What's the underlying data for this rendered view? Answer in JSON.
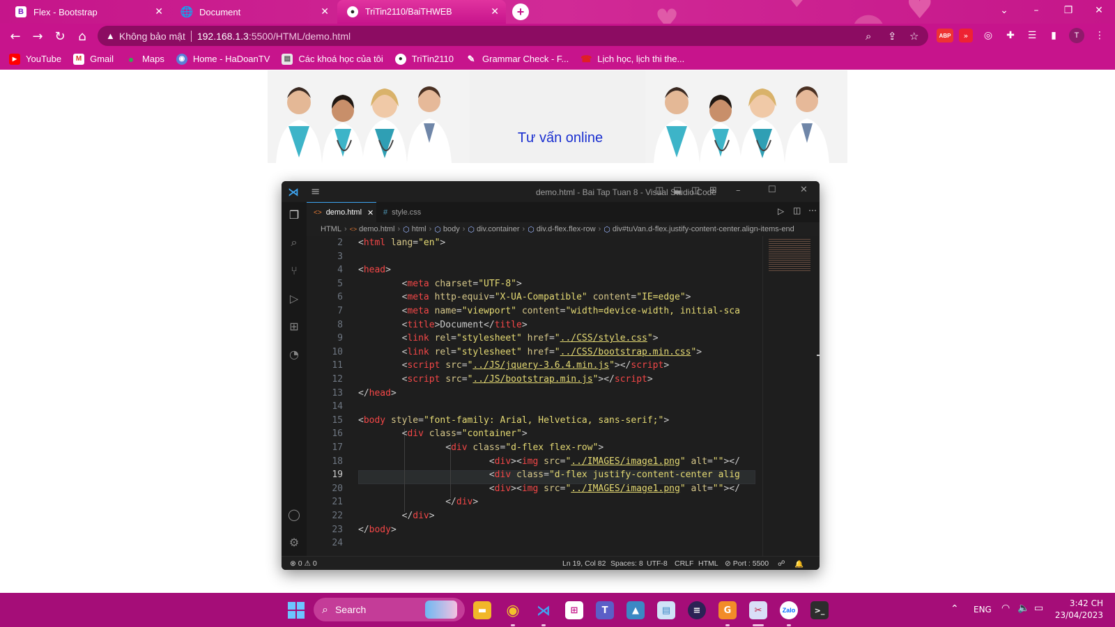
{
  "browser": {
    "tabs": [
      {
        "title": "Flex - Bootstrap",
        "favicon": "B",
        "active": false
      },
      {
        "title": "Document",
        "favicon": "globe-icon",
        "active": false
      },
      {
        "title": "TriTin2110/BaiTHWEB",
        "favicon": "github-icon",
        "active": true
      }
    ],
    "address": {
      "security": "Không bảo mật",
      "host": "192.168.1.3",
      "path": ":5500/HTML/demo.html"
    },
    "profile_initial": "T",
    "ext_abp": "ABP",
    "bookmarks": [
      {
        "label": "YouTube",
        "icon": "youtube-icon"
      },
      {
        "label": "Gmail",
        "icon": "gmail-icon"
      },
      {
        "label": "Maps",
        "icon": "maps-icon"
      },
      {
        "label": "Home - HaDoanTV",
        "icon": "globe-icon"
      },
      {
        "label": "Các khoá học của tôi",
        "icon": "course-icon"
      },
      {
        "label": "TriTin2110",
        "icon": "github-icon"
      },
      {
        "label": "Grammar Check - F...",
        "icon": "grammar-icon"
      },
      {
        "label": "Lịch học, lịch thi the...",
        "icon": "calendar-icon"
      }
    ],
    "colors": {
      "chrome": "#c7148c",
      "accent": "#e1339f"
    }
  },
  "page": {
    "banner_text": "Tư vấn online"
  },
  "vscode": {
    "title": "demo.html - Bai Tap Tuan 8 - Visual Studio Code",
    "tabs": [
      {
        "label": "demo.html",
        "active": true
      },
      {
        "label": "style.css",
        "active": false
      }
    ],
    "breadcrumb": [
      "HTML",
      "demo.html",
      "html",
      "body",
      "div.container",
      "div.d-flex.flex-row",
      "div#tuVan.d-flex.justify-content-center.align-items-end"
    ],
    "current_line": 19,
    "lines": [
      {
        "n": "2",
        "indent": 0,
        "parts": [
          [
            "p",
            "<"
          ],
          [
            "t",
            "html"
          ],
          [
            "a",
            " lang"
          ],
          [
            "p",
            "="
          ],
          [
            "s",
            "\"en\""
          ],
          [
            "p",
            ">"
          ]
        ]
      },
      {
        "n": "3",
        "indent": 0,
        "parts": []
      },
      {
        "n": "4",
        "indent": 0,
        "parts": [
          [
            "p",
            "<"
          ],
          [
            "t",
            "head"
          ],
          [
            "p",
            ">"
          ]
        ]
      },
      {
        "n": "5",
        "indent": 8,
        "parts": [
          [
            "p",
            "<"
          ],
          [
            "t",
            "meta"
          ],
          [
            "a",
            " charset"
          ],
          [
            "p",
            "="
          ],
          [
            "s",
            "\"UTF-8\""
          ],
          [
            "p",
            ">"
          ]
        ]
      },
      {
        "n": "6",
        "indent": 8,
        "parts": [
          [
            "p",
            "<"
          ],
          [
            "t",
            "meta"
          ],
          [
            "a",
            " http-equiv"
          ],
          [
            "p",
            "="
          ],
          [
            "s",
            "\"X-UA-Compatible\""
          ],
          [
            "a",
            " content"
          ],
          [
            "p",
            "="
          ],
          [
            "s",
            "\"IE=edge\""
          ],
          [
            "p",
            ">"
          ]
        ]
      },
      {
        "n": "7",
        "indent": 8,
        "parts": [
          [
            "p",
            "<"
          ],
          [
            "t",
            "meta"
          ],
          [
            "a",
            " name"
          ],
          [
            "p",
            "="
          ],
          [
            "s",
            "\"viewport\""
          ],
          [
            "a",
            " content"
          ],
          [
            "p",
            "="
          ],
          [
            "s",
            "\"width=device-width, initial-sca"
          ]
        ]
      },
      {
        "n": "8",
        "indent": 8,
        "parts": [
          [
            "p",
            "<"
          ],
          [
            "t",
            "title"
          ],
          [
            "p",
            ">Document</"
          ],
          [
            "t",
            "title"
          ],
          [
            "p",
            ">"
          ]
        ]
      },
      {
        "n": "9",
        "indent": 8,
        "parts": [
          [
            "p",
            "<"
          ],
          [
            "t",
            "link"
          ],
          [
            "a",
            " rel"
          ],
          [
            "p",
            "="
          ],
          [
            "s",
            "\"stylesheet\""
          ],
          [
            "a",
            " href"
          ],
          [
            "p",
            "="
          ],
          [
            "s",
            "\""
          ],
          [
            "l",
            "../CSS/style.css"
          ],
          [
            "s",
            "\""
          ],
          [
            "p",
            ">"
          ]
        ]
      },
      {
        "n": "10",
        "indent": 8,
        "parts": [
          [
            "p",
            "<"
          ],
          [
            "t",
            "link"
          ],
          [
            "a",
            " rel"
          ],
          [
            "p",
            "="
          ],
          [
            "s",
            "\"stylesheet\""
          ],
          [
            "a",
            " href"
          ],
          [
            "p",
            "="
          ],
          [
            "s",
            "\""
          ],
          [
            "l",
            "../CSS/bootstrap.min.css"
          ],
          [
            "s",
            "\""
          ],
          [
            "p",
            ">"
          ]
        ]
      },
      {
        "n": "11",
        "indent": 8,
        "parts": [
          [
            "p",
            "<"
          ],
          [
            "t",
            "script"
          ],
          [
            "a",
            " src"
          ],
          [
            "p",
            "="
          ],
          [
            "s",
            "\""
          ],
          [
            "l",
            "../JS/jquery-3.6.4.min.js"
          ],
          [
            "s",
            "\""
          ],
          [
            "p",
            "></"
          ],
          [
            "t",
            "script"
          ],
          [
            "p",
            ">"
          ]
        ]
      },
      {
        "n": "12",
        "indent": 8,
        "parts": [
          [
            "p",
            "<"
          ],
          [
            "t",
            "script"
          ],
          [
            "a",
            " src"
          ],
          [
            "p",
            "="
          ],
          [
            "s",
            "\""
          ],
          [
            "l",
            "../JS/bootstrap.min.js"
          ],
          [
            "s",
            "\""
          ],
          [
            "p",
            "></"
          ],
          [
            "t",
            "script"
          ],
          [
            "p",
            ">"
          ]
        ]
      },
      {
        "n": "13",
        "indent": 0,
        "parts": [
          [
            "p",
            "</"
          ],
          [
            "t",
            "head"
          ],
          [
            "p",
            ">"
          ]
        ]
      },
      {
        "n": "14",
        "indent": 0,
        "parts": []
      },
      {
        "n": "15",
        "indent": 0,
        "parts": [
          [
            "p",
            "<"
          ],
          [
            "t",
            "body"
          ],
          [
            "a",
            " style"
          ],
          [
            "p",
            "="
          ],
          [
            "s",
            "\"font-family: Arial, Helvetica, sans-serif;\""
          ],
          [
            "p",
            ">"
          ]
        ]
      },
      {
        "n": "16",
        "indent": 8,
        "parts": [
          [
            "p",
            "<"
          ],
          [
            "t",
            "div"
          ],
          [
            "a",
            " class"
          ],
          [
            "p",
            "="
          ],
          [
            "s",
            "\"container\""
          ],
          [
            "p",
            ">"
          ]
        ]
      },
      {
        "n": "17",
        "indent": 16,
        "parts": [
          [
            "p",
            "<"
          ],
          [
            "t",
            "div"
          ],
          [
            "a",
            " class"
          ],
          [
            "p",
            "="
          ],
          [
            "s",
            "\"d-flex flex-row\""
          ],
          [
            "p",
            ">"
          ]
        ]
      },
      {
        "n": "18",
        "indent": 24,
        "parts": [
          [
            "p",
            "<"
          ],
          [
            "t",
            "div"
          ],
          [
            "p",
            "><"
          ],
          [
            "t",
            "img"
          ],
          [
            "a",
            " src"
          ],
          [
            "p",
            "="
          ],
          [
            "s",
            "\""
          ],
          [
            "l",
            "../IMAGES/image1.png"
          ],
          [
            "s",
            "\""
          ],
          [
            "a",
            " alt"
          ],
          [
            "p",
            "="
          ],
          [
            "s",
            "\"\""
          ],
          [
            "p",
            "></"
          ]
        ]
      },
      {
        "n": "19",
        "indent": 24,
        "parts": [
          [
            "p",
            "<"
          ],
          [
            "t",
            "div"
          ],
          [
            "a",
            " class"
          ],
          [
            "p",
            "="
          ],
          [
            "s",
            "\"d-flex justify-content-center alig"
          ]
        ]
      },
      {
        "n": "20",
        "indent": 24,
        "parts": [
          [
            "p",
            "<"
          ],
          [
            "t",
            "div"
          ],
          [
            "p",
            "><"
          ],
          [
            "t",
            "img"
          ],
          [
            "a",
            " src"
          ],
          [
            "p",
            "="
          ],
          [
            "s",
            "\""
          ],
          [
            "l",
            "../IMAGES/image1.png"
          ],
          [
            "s",
            "\""
          ],
          [
            "a",
            " alt"
          ],
          [
            "p",
            "="
          ],
          [
            "s",
            "\"\""
          ],
          [
            "p",
            "></"
          ]
        ]
      },
      {
        "n": "21",
        "indent": 16,
        "parts": [
          [
            "p",
            "</"
          ],
          [
            "t",
            "div"
          ],
          [
            "p",
            ">"
          ]
        ]
      },
      {
        "n": "22",
        "indent": 8,
        "parts": [
          [
            "p",
            "</"
          ],
          [
            "t",
            "div"
          ],
          [
            "p",
            ">"
          ]
        ]
      },
      {
        "n": "23",
        "indent": 0,
        "parts": [
          [
            "p",
            "</"
          ],
          [
            "t",
            "body"
          ],
          [
            "p",
            ">"
          ]
        ]
      },
      {
        "n": "24",
        "indent": 0,
        "parts": []
      }
    ],
    "status": {
      "errors": "0",
      "warnings": "0",
      "position": "Ln 19, Col 82",
      "spaces": "Spaces: 8",
      "encoding": "UTF-8",
      "eol": "CRLF",
      "language": "HTML",
      "port": "Port : 5500"
    }
  },
  "taskbar": {
    "search_label": "Search",
    "language": "ENG",
    "time": "3:42 CH",
    "date": "23/04/2023",
    "pinned": [
      "file-explorer-icon",
      "chrome-icon",
      "vscode-icon",
      "store-icon",
      "teams-icon",
      "photos-icon",
      "control-panel-icon",
      "eclipse-icon",
      "pdf-icon",
      "snipping-icon",
      "zalo-icon",
      "terminal-icon"
    ],
    "zalo_label": "Zalo"
  }
}
